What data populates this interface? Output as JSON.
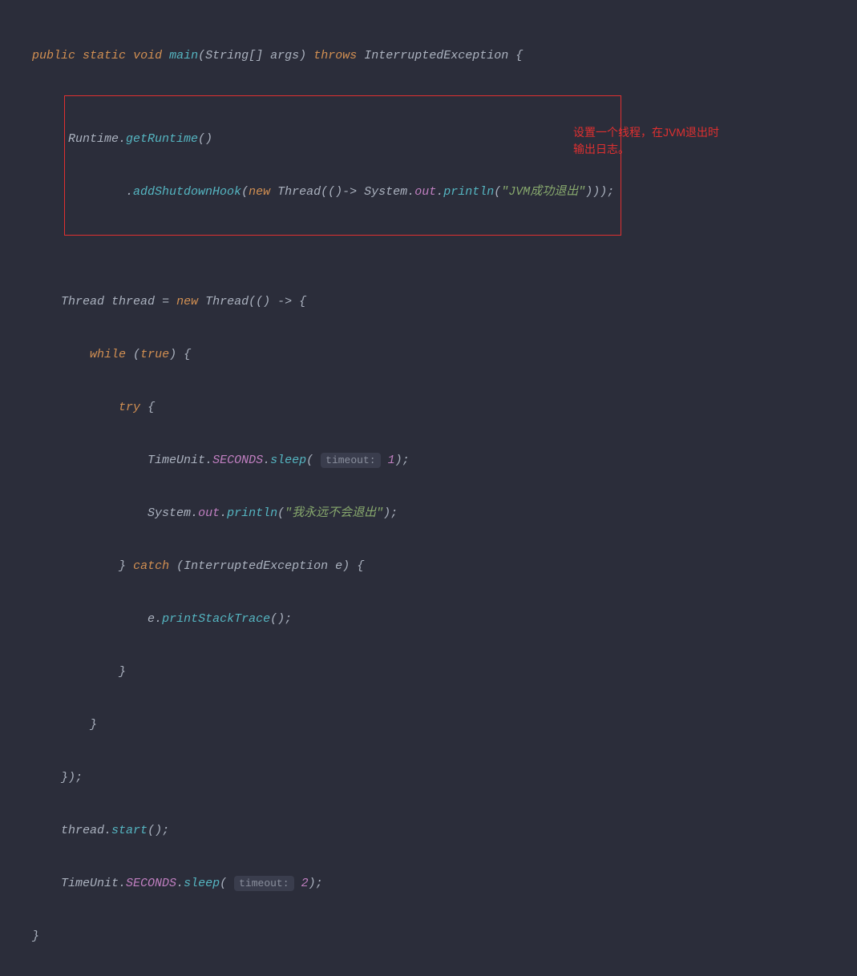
{
  "code": {
    "kw_public": "public",
    "kw_static": "static",
    "kw_void": "void",
    "method_main": "main",
    "type_string_arr": "String[]",
    "param_args": "args",
    "kw_throws": "throws",
    "exc_interrupted": "InterruptedException",
    "brace_open": "{",
    "brace_close": "}",
    "runtime": "Runtime",
    "get_runtime": "getRuntime",
    "add_hook": "addShutdownHook",
    "kw_new": "new",
    "thread_class": "Thread",
    "system": "System",
    "out_field": "out",
    "println": "println",
    "str_jvm_exit": "\"JVM成功退出\"",
    "thread_var": "thread",
    "assign_eq": " = ",
    "arrow": "() -> {",
    "arrow2": "()-> ",
    "kw_while": "while",
    "kw_true": "true",
    "kw_try": "try",
    "timeunit": "TimeUnit",
    "seconds": "SECONDS",
    "sleep": "sleep",
    "hint_timeout": "timeout:",
    "num_1": "1",
    "num_2": "2",
    "str_never_exit": "\"我永远不会退出\"",
    "kw_catch": "catch",
    "exc_var": "e",
    "print_stack": "printStackTrace",
    "start": "start",
    "paren_open": "(",
    "paren_close": ")",
    "semicolon": ";",
    "dot": ".",
    "closing_paren_semi": "();",
    "triple_close": ")));",
    "close_brace_paren_semi": "});"
  },
  "annotation": {
    "line1": "设置一个线程，在JVM退出时",
    "line2": "输出日志。"
  }
}
